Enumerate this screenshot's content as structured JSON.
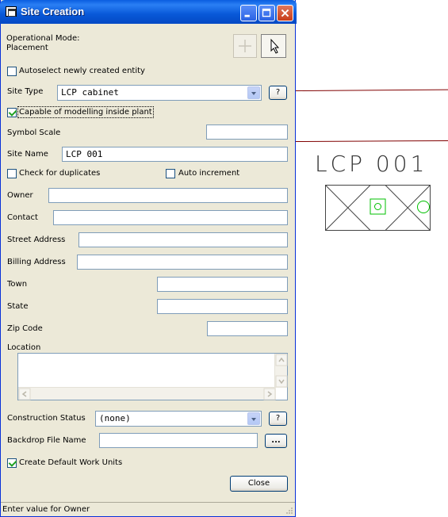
{
  "window": {
    "title": "Site Creation"
  },
  "mode": {
    "label": "Operational Mode:",
    "value": "Placement"
  },
  "autoselect": {
    "label": "Autoselect newly created entity",
    "checked": false
  },
  "site_type": {
    "label": "Site Type",
    "value": "LCP cabinet",
    "help": "?"
  },
  "capable": {
    "label": "Capable of modelling inside plant",
    "checked": true
  },
  "symbol_scale": {
    "label": "Symbol Scale",
    "value": ""
  },
  "site_name": {
    "label": "Site Name",
    "value": "LCP 001"
  },
  "check_duplicates": {
    "label": "Check for duplicates",
    "checked": false
  },
  "auto_increment": {
    "label": "Auto increment",
    "checked": false
  },
  "owner": {
    "label": "Owner",
    "value": ""
  },
  "contact": {
    "label": "Contact",
    "value": ""
  },
  "street_address": {
    "label": "Street Address",
    "value": ""
  },
  "billing_address": {
    "label": "Billing Address",
    "value": ""
  },
  "town": {
    "label": "Town",
    "value": ""
  },
  "state": {
    "label": "State",
    "value": ""
  },
  "zip_code": {
    "label": "Zip Code",
    "value": ""
  },
  "location": {
    "label": "Location",
    "value": ""
  },
  "construction_status": {
    "label": "Construction Status",
    "value": "(none)",
    "help": "?"
  },
  "backdrop": {
    "label": "Backdrop File Name",
    "value": "",
    "browse": "..."
  },
  "default_work_units": {
    "label": "Create Default Work Units",
    "checked": true
  },
  "close_button": "Close",
  "status": "Enter value for Owner",
  "canvas": {
    "symbol_label": "LCP 001"
  },
  "colors": {
    "title_blue": "#0858d8",
    "symbol_green": "#00c000",
    "line_maroon": "#800000"
  }
}
